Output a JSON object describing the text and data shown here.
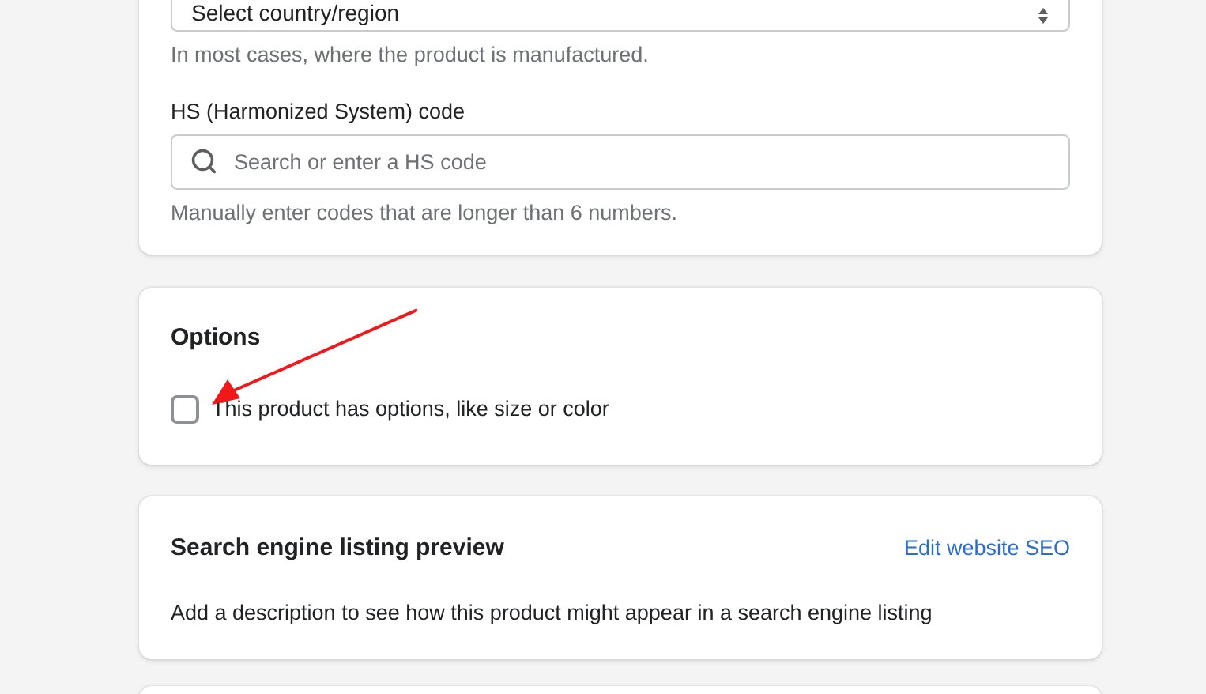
{
  "shipping_card": {
    "country_select": {
      "value": "Select country/region"
    },
    "country_help": "In most cases, where the product is manufactured.",
    "hs_label": "HS (Harmonized System) code",
    "hs_field": {
      "placeholder": "Search or enter a HS code"
    },
    "hs_help": "Manually enter codes that are longer than 6 numbers."
  },
  "options_card": {
    "title": "Options",
    "checkbox": {
      "label": "This product has options, like size or color",
      "checked": false
    }
  },
  "seo_card": {
    "title": "Search engine listing preview",
    "link": "Edit website SEO",
    "description": "Add a description to see how this product might appear in a search engine listing"
  }
}
